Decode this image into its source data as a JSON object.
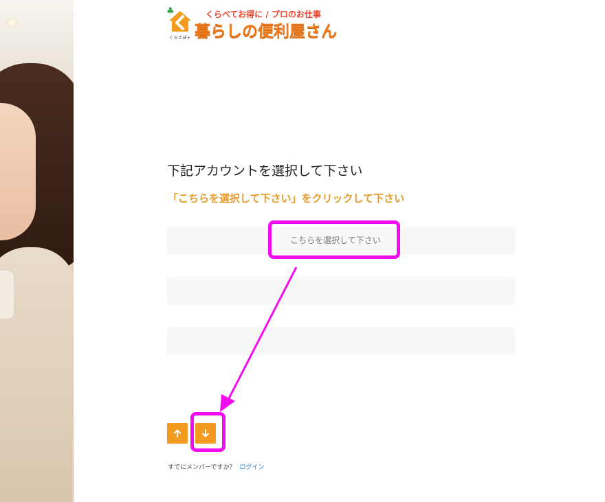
{
  "logo": {
    "tagline": "くらべてお得に / プロのお仕事",
    "name": "暮らしの便利屋さん",
    "sub": "くらさぽ+",
    "icon": "house-logo-icon"
  },
  "title": "下記アカウントを選択して下さい",
  "instruction": "「こちらを選択して下さい」をクリックして下さい",
  "options": [
    {
      "label": "こちらを選択して下さい"
    },
    {
      "label": ""
    },
    {
      "label": ""
    }
  ],
  "nav": {
    "up_icon": "arrow-up-icon",
    "down_icon": "arrow-down-icon"
  },
  "member": {
    "prompt": "すでにメンバーですか？",
    "login_label": "ログイン"
  },
  "colors": {
    "accent": "#f39b1f",
    "instruction": "#e89a2a",
    "highlight": "#f20cf0",
    "link": "#2b7fd0"
  }
}
